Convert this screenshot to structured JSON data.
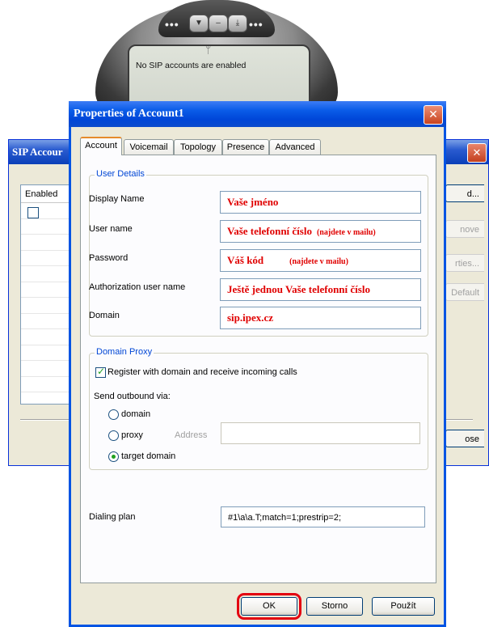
{
  "phone": {
    "screen_text": "No SIP accounts are enabled",
    "buttons": [
      "chevron-down",
      "minimize",
      "download"
    ]
  },
  "sip_window": {
    "title": "SIP Accour",
    "enabled_header": "Enabled",
    "buttons": [
      "d...",
      "nove",
      "rties...",
      "Default",
      "ose"
    ]
  },
  "dialog": {
    "title": "Properties of Account1",
    "tabs": [
      {
        "label": "Account",
        "selected": true
      },
      {
        "label": "Voicemail"
      },
      {
        "label": "Topology"
      },
      {
        "label": "Presence"
      },
      {
        "label": "Advanced"
      }
    ],
    "user_details": {
      "legend": "User Details",
      "display_name": {
        "label": "Display Name",
        "value": "Vaše jméno"
      },
      "user_name": {
        "label": "User name",
        "value": "Vaše telefonní číslo",
        "note": "(najdete v mailu)"
      },
      "password": {
        "label": "Password",
        "value": "Váš kód",
        "note": "(najdete v mailu)"
      },
      "auth_user_name": {
        "label": "Authorization user name",
        "value": "Ještě jednou Vaše telefonní číslo"
      },
      "domain": {
        "label": "Domain",
        "value": "sip.ipex.cz"
      }
    },
    "domain_proxy": {
      "legend": "Domain Proxy",
      "register_label": "Register with domain and receive incoming calls",
      "register_checked": true,
      "send_outbound_label": "Send outbound via:",
      "options": [
        "domain",
        "proxy",
        "target domain"
      ],
      "selected_option": "target domain",
      "address_label": "Address",
      "address_value": ""
    },
    "dialing_plan": {
      "label": "Dialing plan",
      "value": "#1\\a\\a.T;match=1;prestrip=2;"
    },
    "buttons": {
      "ok": "OK",
      "cancel": "Storno",
      "apply": "Použít"
    }
  }
}
